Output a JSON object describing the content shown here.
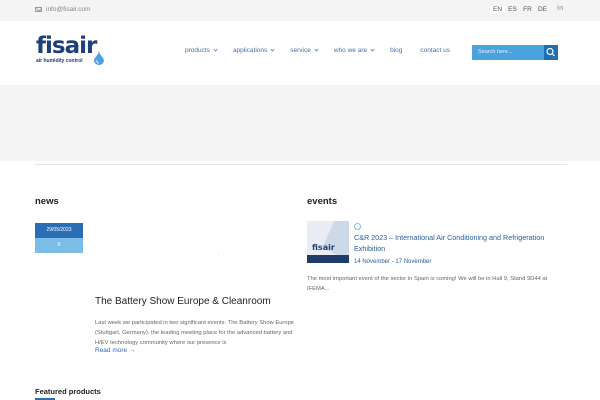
{
  "topbar": {
    "email": "info@fisair.com",
    "languages": [
      "EN",
      "ES",
      "FR",
      "DE"
    ],
    "social_icon": "in"
  },
  "header": {
    "logo_word": "fisair",
    "logo_tagline": "air humidity control",
    "nav": [
      "products",
      "applications",
      "service",
      "who we are",
      "blog",
      "contact us"
    ],
    "search_placeholder": "Search here..."
  },
  "news": {
    "heading": "news",
    "date": "29/05/2023",
    "comments": "0",
    "title": "The Battery Show Europe & Cleanroom",
    "excerpt": "Last week we participated in two significant events: The Battery Show Europe (Stuttgart, Germany): the leading meeting place for the advanced battery and H/EV technology community where our presence is",
    "read_more": "Read more"
  },
  "events": {
    "heading": "events",
    "title": "C&R 2023 – International Air Conditioning and Refrigeration Exhibition",
    "dates": "14 November - 17 November",
    "description": "The most important event of the sector in Spain is coming! We will be in Hall 9, Stand 9D44 at IFEMA...",
    "thumb_logo": "fisair"
  },
  "featured": {
    "heading": "Featured products"
  },
  "colors": {
    "accent": "#2a6fb5",
    "brand": "#1f3f7a",
    "light_accent": "#7cbde8"
  }
}
